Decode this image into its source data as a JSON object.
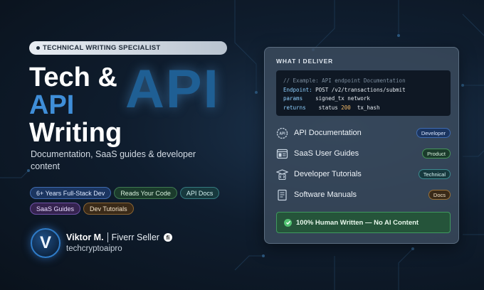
{
  "badge": "TECHNICAL WRITING SPECIALIST",
  "headline": {
    "line1": "Tech &",
    "line2": "API",
    "line3": "Writing"
  },
  "watermark": "API",
  "subtitle": "Documentation, SaaS guides & developer content",
  "tags": [
    [
      {
        "label": "6+ Years Full-Stack Dev",
        "color": "blue"
      },
      {
        "label": "Reads Your Code",
        "color": "green"
      },
      {
        "label": "API Docs",
        "color": "teal"
      }
    ],
    [
      {
        "label": "SaaS Guides",
        "color": "purple"
      },
      {
        "label": "Dev Tutorials",
        "color": "orange"
      }
    ]
  ],
  "profile": {
    "avatar_letter": "V",
    "name": "Viktor M.",
    "role": "Fiverr Seller",
    "fiverr_mark": "fi",
    "handle": "techcryptoaipro"
  },
  "panel": {
    "title": "WHAT I DELIVER",
    "code": {
      "comment": "// Example: API endpoint Documentation",
      "endpoint_key": "Endpoint:",
      "endpoint_val": "POST /v2/transactions/submit",
      "params_key": "params",
      "params_val": "signed_tx network",
      "returns_key": "returns",
      "returns_status": "status",
      "returns_code": "200",
      "returns_field": "tx_hash"
    },
    "services": [
      {
        "label": "API Documentation",
        "pill": "Developer",
        "color": "blue",
        "icon": "api-gear-icon"
      },
      {
        "label": "SaaS User Guides",
        "pill": "Product",
        "color": "green",
        "icon": "browser-window-icon"
      },
      {
        "label": "Developer Tutorials",
        "pill": "Technical",
        "color": "teal",
        "icon": "graduation-code-icon"
      },
      {
        "label": "Software Manuals",
        "pill": "Docs",
        "color": "orange",
        "icon": "manual-book-icon"
      }
    ],
    "human_badge": "100% Human Written — No AI Content"
  }
}
